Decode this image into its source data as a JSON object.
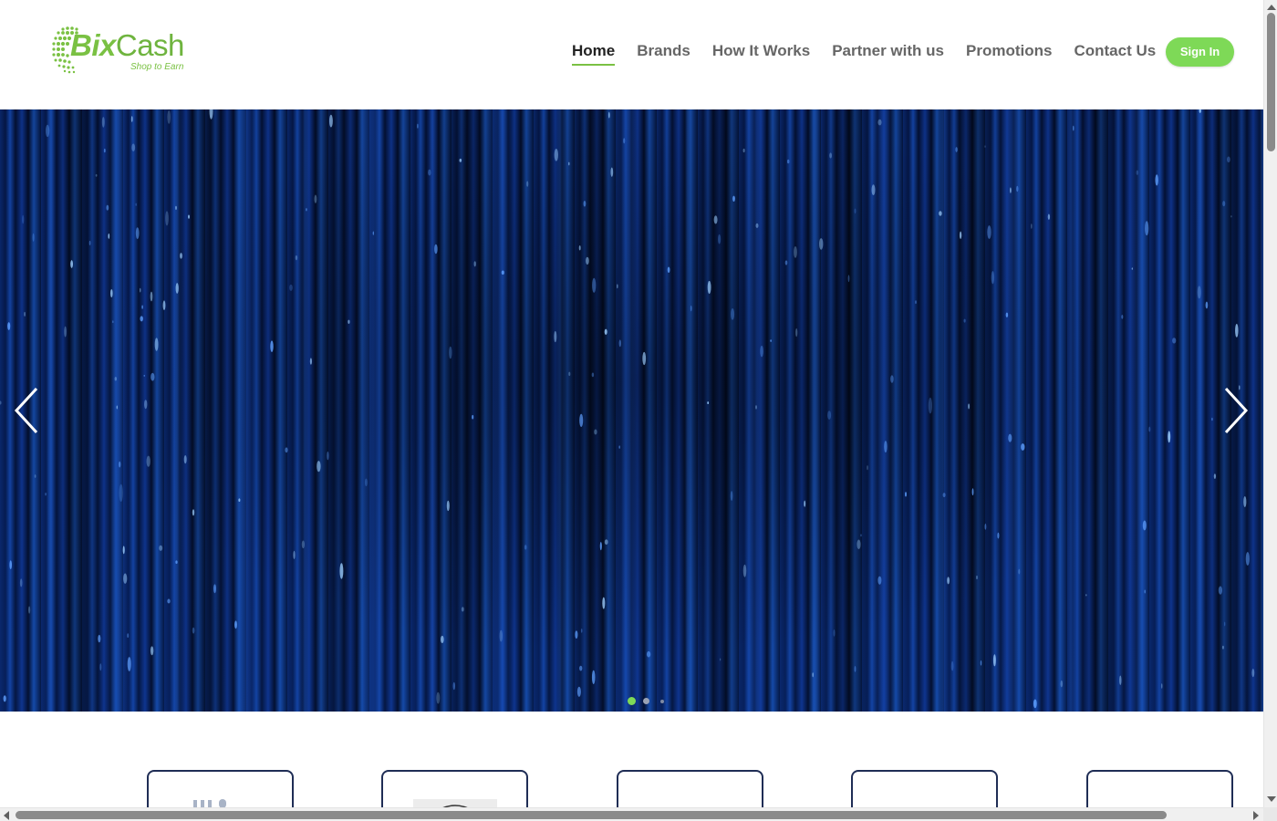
{
  "brand": {
    "name_part1": "Bix",
    "name_part2": "Cash",
    "tagline": "Shop to Earn",
    "primary_color": "#7ac143",
    "accent_color": "#7ed957"
  },
  "nav": {
    "items": [
      {
        "label": "Home",
        "active": true
      },
      {
        "label": "Brands",
        "active": false
      },
      {
        "label": "How It Works",
        "active": false
      },
      {
        "label": "Partner with us",
        "active": false
      },
      {
        "label": "Promotions",
        "active": false
      },
      {
        "label": "Contact Us",
        "active": false
      }
    ],
    "signin_label": "Sign In"
  },
  "slider": {
    "prev_icon": "chevron-left-icon",
    "next_icon": "chevron-right-icon",
    "slide_count": 3,
    "active_slide": 1
  },
  "brand_cards": {
    "count_visible": 5
  }
}
